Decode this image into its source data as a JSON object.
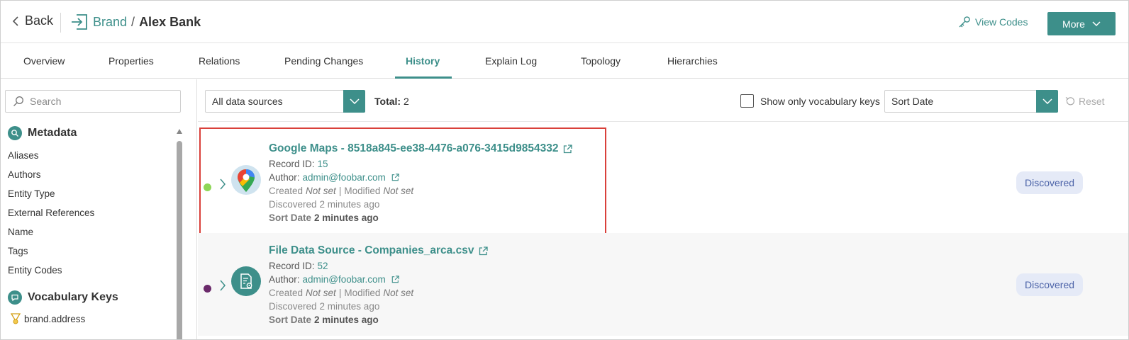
{
  "header": {
    "back_label": "Back",
    "breadcrumb_parent": "Brand",
    "breadcrumb_separator": "/",
    "breadcrumb_current": "Alex Bank",
    "view_codes_label": "View Codes",
    "more_label": "More"
  },
  "tabs": [
    {
      "label": "Overview"
    },
    {
      "label": "Properties"
    },
    {
      "label": "Relations"
    },
    {
      "label": "Pending Changes"
    },
    {
      "label": "History",
      "active": true
    },
    {
      "label": "Explain Log"
    },
    {
      "label": "Topology"
    },
    {
      "label": "Hierarchies"
    }
  ],
  "sidebar": {
    "search_placeholder": "Search",
    "metadata_title": "Metadata",
    "metadata_items": [
      "Aliases",
      "Authors",
      "Entity Type",
      "External References",
      "Name",
      "Tags",
      "Entity Codes"
    ],
    "vocabulary_title": "Vocabulary Keys",
    "vocabulary_items": [
      "brand.address"
    ]
  },
  "toolbar": {
    "source_select_value": "All data sources",
    "total_label": "Total:",
    "total_value": "2",
    "vocab_checkbox_label": "Show only vocabulary keys",
    "vocab_checkbox_checked": false,
    "sort_select_value": "Sort Date",
    "reset_label": "Reset"
  },
  "records": [
    {
      "title": "Google Maps - 8518a845-ee38-4476-a076-3415d9854332",
      "record_id_label": "Record ID:",
      "record_id": "15",
      "author_label": "Author:",
      "author": "admin@foobar.com",
      "created_label": "Created",
      "created_value": "Not set",
      "separator": "|",
      "modified_label": "Modified",
      "modified_value": "Not set",
      "discovered_label": "Discovered",
      "discovered_value": "2 minutes ago",
      "sort_label": "Sort Date",
      "sort_value": "2 minutes ago",
      "status": "Discovered",
      "dot_color": "#8ed657",
      "logo": "google-maps-icon",
      "highlighted": true
    },
    {
      "title": "File Data Source - Companies_arca.csv",
      "record_id_label": "Record ID:",
      "record_id": "52",
      "author_label": "Author:",
      "author": "admin@foobar.com",
      "created_label": "Created",
      "created_value": "Not set",
      "separator": "|",
      "modified_label": "Modified",
      "modified_value": "Not set",
      "discovered_label": "Discovered",
      "discovered_value": "2 minutes ago",
      "sort_label": "Sort Date",
      "sort_value": "2 minutes ago",
      "status": "Discovered",
      "dot_color": "#6b2a6b",
      "logo": "file-data-source-icon",
      "highlighted": false
    }
  ],
  "colors": {
    "accent": "#3d8f8a",
    "highlight_border": "#d9403a",
    "badge_bg": "#e5eaf7",
    "badge_text": "#4c63a8"
  }
}
